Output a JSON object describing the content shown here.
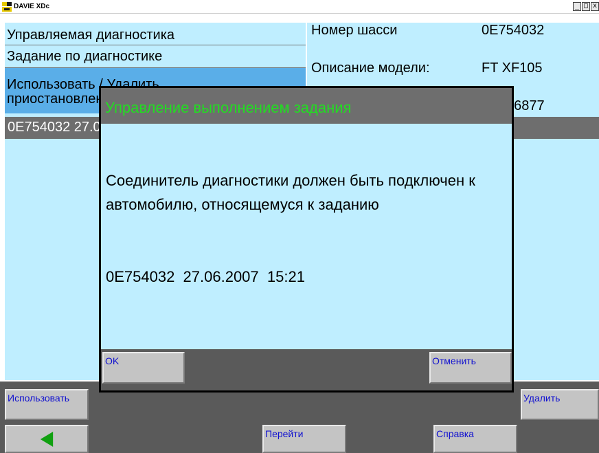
{
  "window": {
    "title": "DAVIE XDc",
    "controls": [
      "minimize-icon",
      "maximize-icon",
      "close-icon"
    ],
    "control_glyphs": [
      "_",
      "□",
      "x"
    ]
  },
  "left_panel": {
    "items": [
      {
        "label": "Управляемая диагностика"
      },
      {
        "label": "Задание по диагностике"
      },
      {
        "label": "Использовать / Удалить"
      },
      {
        "label": "приостановленные задания"
      }
    ],
    "selected_job": "0E754032 27.06.2007 15:21"
  },
  "right_panel": {
    "fields": [
      {
        "label": "Номер шасси",
        "value": "0E754032"
      },
      {
        "label": "Описание модели:",
        "value": "FT XF105"
      },
      {
        "label": "",
        "value": "16877"
      }
    ]
  },
  "toolbar_row1": {
    "use_label": "Использовать",
    "delete_label": "Удалить"
  },
  "toolbar_row2": {
    "back_icon": "back-arrow-icon",
    "goto_label": "Перейти",
    "help_label": "Справка"
  },
  "dialog": {
    "title": "Управление выполнением задания",
    "message": "Соединитель диагностики должен быть подключен к автомобилю, относящемуся к заданию",
    "job_stamp": "0E754032  27.06.2007  15:21",
    "ok_label": "OK",
    "cancel_label": "Отменить"
  },
  "colors": {
    "panel_bg": "#bfeeff",
    "selected_bg": "#5aaee8",
    "dark_strip": "#5a5a5a",
    "header_gray": "#6e6e6e",
    "dialog_title": "#22dd22",
    "button_text": "#1010d0",
    "back_arrow": "#10a010"
  }
}
